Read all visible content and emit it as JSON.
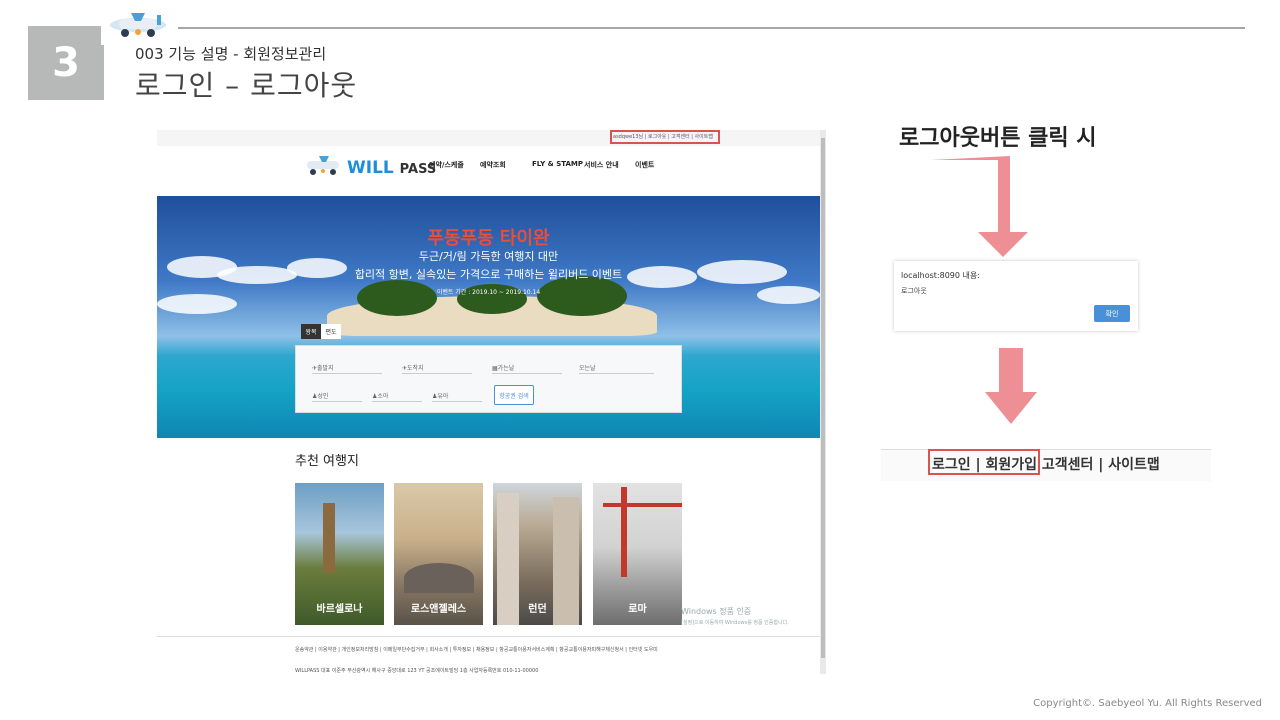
{
  "slide": {
    "number": "3",
    "subtitle": "003 기능 설명 - 회원정보관리",
    "title": "로그인 – 로그아웃",
    "copyright": "Copyright©. Saebyeol Yu. All Rights Reserved"
  },
  "site": {
    "top_links": "asdqwe13님 | 로그아웃 | 고객센터 | 사이트맵",
    "logo_main": "WILL",
    "logo_sub": "PASS",
    "nav": [
      "예약/스케줄",
      "예약조회",
      "FLY & STAMP",
      "서비스 안내",
      "이벤트"
    ],
    "hero": {
      "title": "푸동푸동 타이완",
      "sub1": "두근/거/림 가득한 여행지 대만",
      "sub2": "합리적 항변, 실속있는 가격으로 구매하는 윌리버드 이벤트",
      "date": "이벤트 기간 : 2019.10 ~ 2019.10.14"
    },
    "search": {
      "tab_round": "왕복",
      "tab_oneway": "편도",
      "depart": "출발지",
      "arrive": "도착지",
      "go_date": "가는날",
      "back_date": "오는날",
      "adult": "성인",
      "child": "소아",
      "infant": "유아",
      "button": "항공권 검색"
    },
    "recommend_title": "추천 여행지",
    "cards": [
      "바르셀로나",
      "로스앤젤레스",
      "런던",
      "로마"
    ],
    "footer_links": "운송약관 | 이용약관 | 개인정보처리방침 | 이메일무단수집거부 | 회사소개 | 투자정보 | 채용정보 | 항공교통이용자서비스계획 | 항공교통이용자피해구제신청서 | 인터넷 도우미",
    "footer_info": "WILLPASS 대표 이준주 부산광역시 해사구 중앙대로 123 YT 공조에이트빌딩 1층 사업자등록번호 010-11-00000",
    "watermark_title": "Windows 정품 인증",
    "watermark_sub": "[설정]으로 이동하여 Windows를 정품 인증합니다."
  },
  "annotation": {
    "click_label": "로그아웃버튼 클릭 시",
    "dialog_title": "localhost:8090 내용:",
    "dialog_message": "로그아웃",
    "dialog_ok": "확인",
    "result_links_boxed": "로그인 | 회원가입",
    "result_links_rest": " 고객센터 | 사이트맵"
  },
  "colors": {
    "accent_red": "#d9534f",
    "arrow_pink": "#ee8f96",
    "slide_number_bg": "#b7b9b9",
    "hero_title": "#e94e3a"
  }
}
